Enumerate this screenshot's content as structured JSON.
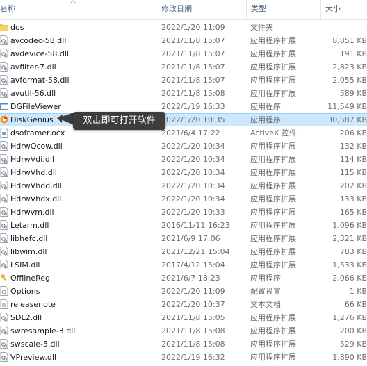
{
  "header": {
    "name": "名称",
    "date": "修改日期",
    "type": "类型",
    "size": "大小"
  },
  "callout": "双击即可打开软件",
  "files": [
    {
      "name": "dos",
      "date": "2022/1/20 11:09",
      "type": "文件夹",
      "size": "",
      "icon": "folder-icon"
    },
    {
      "name": "avcodec-58.dll",
      "date": "2021/11/8 15:07",
      "type": "应用程序扩展",
      "size": "8,851 KB",
      "icon": "dll-icon"
    },
    {
      "name": "avdevice-58.dll",
      "date": "2021/11/8 15:07",
      "type": "应用程序扩展",
      "size": "191 KB",
      "icon": "dll-icon"
    },
    {
      "name": "avfilter-7.dll",
      "date": "2021/11/8 15:07",
      "type": "应用程序扩展",
      "size": "2,823 KB",
      "icon": "dll-icon"
    },
    {
      "name": "avformat-58.dll",
      "date": "2021/11/8 15:07",
      "type": "应用程序扩展",
      "size": "2,055 KB",
      "icon": "dll-icon"
    },
    {
      "name": "avutil-56.dll",
      "date": "2021/11/8 15:08",
      "type": "应用程序扩展",
      "size": "589 KB",
      "icon": "dll-icon"
    },
    {
      "name": "DGFileViewer",
      "date": "2022/1/19 16:33",
      "type": "应用程序",
      "size": "11,549 KB",
      "icon": "app-icon"
    },
    {
      "name": "DiskGenius",
      "date": "2022/1/20 10:35",
      "type": "应用程序",
      "size": "30,587 KB",
      "icon": "diskgenius-icon",
      "selected": true
    },
    {
      "name": "dsoframer.ocx",
      "date": "2021/6/4 17:22",
      "type": "ActiveX 控件",
      "size": "206 KB",
      "icon": "ocx-icon"
    },
    {
      "name": "HdrwQcow.dll",
      "date": "2022/1/20 10:34",
      "type": "应用程序扩展",
      "size": "132 KB",
      "icon": "dll-icon"
    },
    {
      "name": "HdrwVdi.dll",
      "date": "2022/1/20 10:34",
      "type": "应用程序扩展",
      "size": "114 KB",
      "icon": "dll-icon"
    },
    {
      "name": "HdrwVhd.dll",
      "date": "2022/1/20 10:34",
      "type": "应用程序扩展",
      "size": "115 KB",
      "icon": "dll-icon"
    },
    {
      "name": "HdrwVhdd.dll",
      "date": "2022/1/20 10:34",
      "type": "应用程序扩展",
      "size": "202 KB",
      "icon": "dll-icon"
    },
    {
      "name": "HdrwVhdx.dll",
      "date": "2022/1/20 10:34",
      "type": "应用程序扩展",
      "size": "133 KB",
      "icon": "dll-icon"
    },
    {
      "name": "Hdrwvm.dll",
      "date": "2022/1/20 10:33",
      "type": "应用程序扩展",
      "size": "165 KB",
      "icon": "dll-icon"
    },
    {
      "name": "Letarm.dll",
      "date": "2016/11/11 16:23",
      "type": "应用程序扩展",
      "size": "1,096 KB",
      "icon": "dll-icon"
    },
    {
      "name": "libhefc.dll",
      "date": "2021/6/9 17:06",
      "type": "应用程序扩展",
      "size": "2,321 KB",
      "icon": "dll-icon"
    },
    {
      "name": "libwim.dll",
      "date": "2021/12/21 15:04",
      "type": "应用程序扩展",
      "size": "783 KB",
      "icon": "dll-icon"
    },
    {
      "name": "LSIM.dll",
      "date": "2017/4/12 15:04",
      "type": "应用程序扩展",
      "size": "1,533 KB",
      "icon": "dll-icon"
    },
    {
      "name": "OfflineReg",
      "date": "2021/6/7 18:23",
      "type": "应用程序",
      "size": "2,066 KB",
      "icon": "key-icon"
    },
    {
      "name": "Options",
      "date": "2022/1/20 11:09",
      "type": "配置设置",
      "size": "1 KB",
      "icon": "config-icon"
    },
    {
      "name": "releasenote",
      "date": "2022/1/20 10:37",
      "type": "文本文档",
      "size": "66 KB",
      "icon": "text-icon"
    },
    {
      "name": "SDL2.dll",
      "date": "2021/11/8 15:05",
      "type": "应用程序扩展",
      "size": "1,276 KB",
      "icon": "dll-icon"
    },
    {
      "name": "swresample-3.dll",
      "date": "2021/11/8 15:08",
      "type": "应用程序扩展",
      "size": "200 KB",
      "icon": "dll-icon"
    },
    {
      "name": "swscale-5.dll",
      "date": "2021/11/8 15:08",
      "type": "应用程序扩展",
      "size": "529 KB",
      "icon": "dll-icon"
    },
    {
      "name": "VPreview.dll",
      "date": "2022/1/19 16:32",
      "type": "应用程序扩展",
      "size": "1,890 KB",
      "icon": "dll-icon"
    }
  ]
}
